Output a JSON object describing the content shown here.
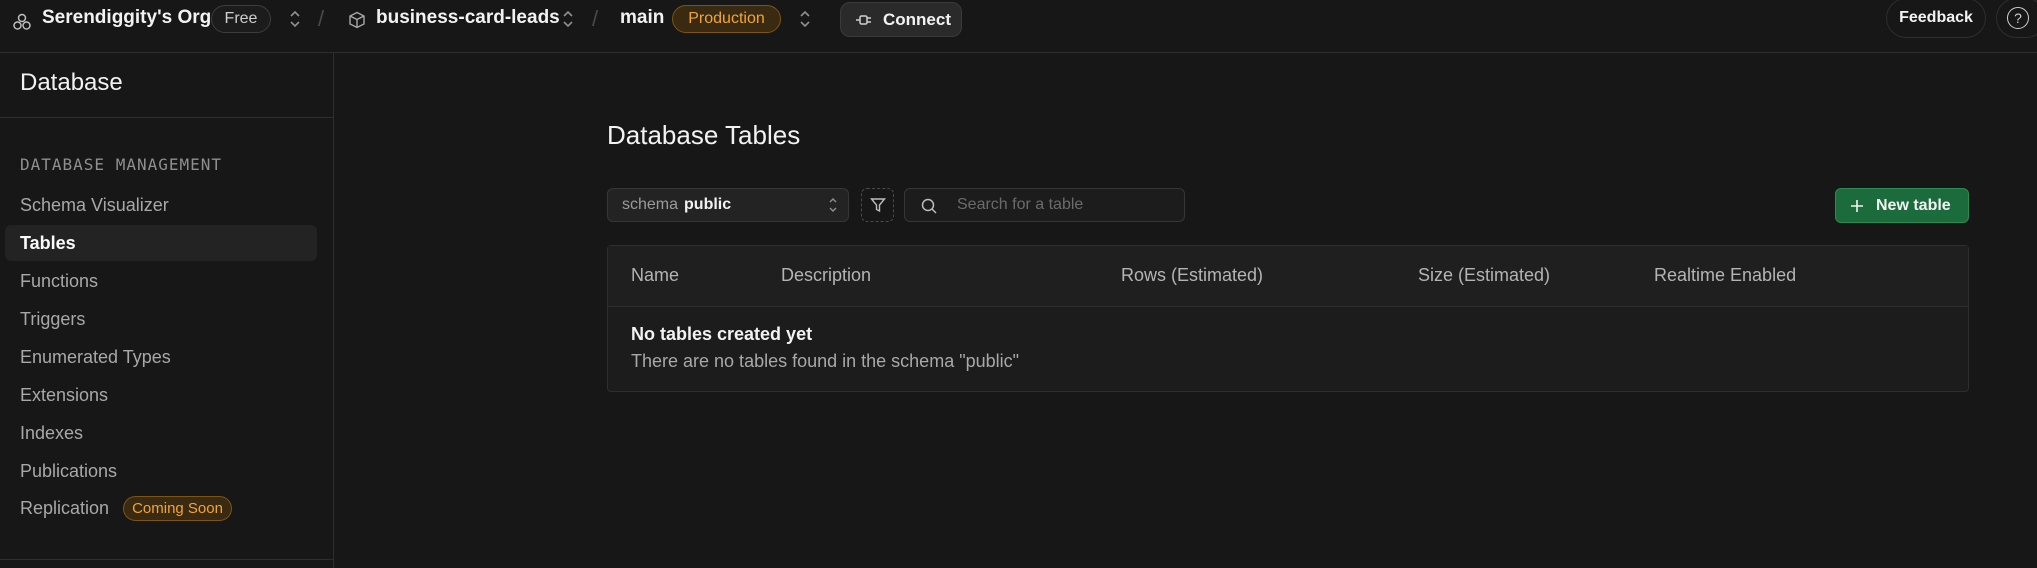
{
  "topbar": {
    "org_name": "Serendiggity's Org",
    "plan_badge": "Free",
    "project_name": "business-card-leads",
    "branch_name": "main",
    "env_badge": "Production",
    "connect_label": "Connect",
    "feedback_label": "Feedback",
    "help_glyph": "?"
  },
  "sidebar": {
    "title": "Database",
    "section_label": "DATABASE MANAGEMENT",
    "items": [
      {
        "label": "Schema Visualizer"
      },
      {
        "label": "Tables"
      },
      {
        "label": "Functions"
      },
      {
        "label": "Triggers"
      },
      {
        "label": "Enumerated Types"
      },
      {
        "label": "Extensions"
      },
      {
        "label": "Indexes"
      },
      {
        "label": "Publications"
      },
      {
        "label": "Replication",
        "badge": "Coming Soon"
      }
    ],
    "active_item": "Tables"
  },
  "main": {
    "title": "Database Tables",
    "schema_label": "schema",
    "schema_value": "public",
    "search_placeholder": "Search for a table",
    "new_table_label": "New table",
    "columns": [
      "Name",
      "Description",
      "Rows (Estimated)",
      "Size (Estimated)",
      "Realtime Enabled"
    ],
    "empty_title": "No tables created yet",
    "empty_description": "There are no tables found in the schema \"public\""
  },
  "colors": {
    "background": "#171717",
    "accent_green": "#1c6b3d",
    "badge_orange": "#f0a43a"
  },
  "icons": [
    "org-icon",
    "chevron-updown-icon",
    "cube-icon",
    "plug-icon",
    "help-icon",
    "filter-icon",
    "search-icon",
    "plus-icon"
  ]
}
